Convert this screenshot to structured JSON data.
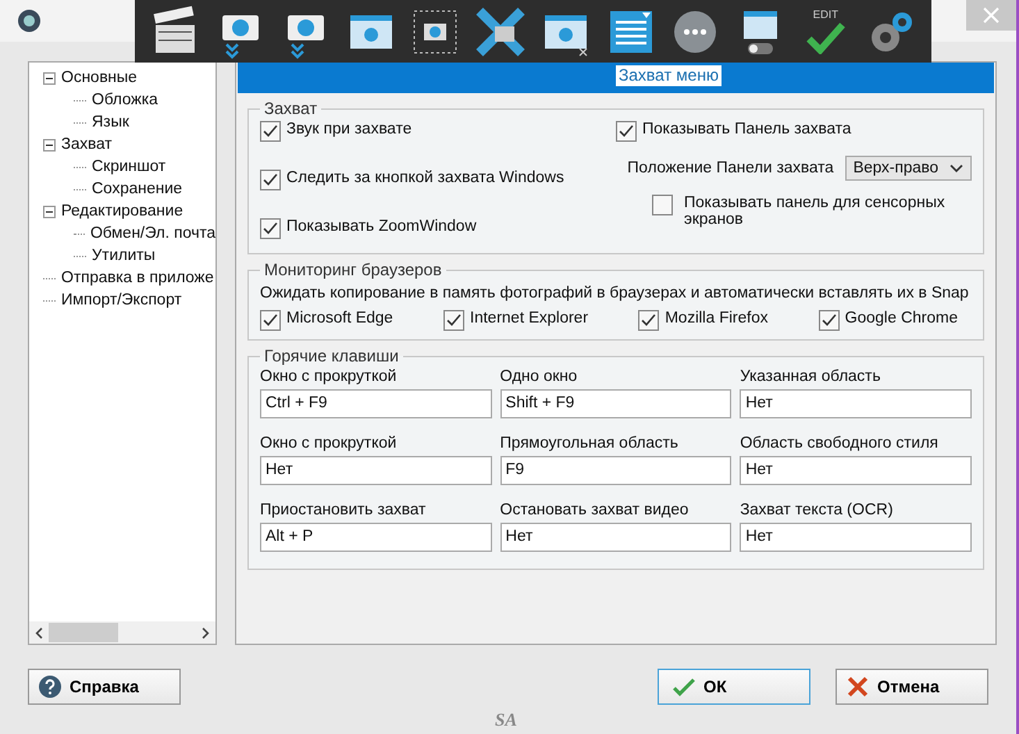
{
  "toolbar": {
    "edit_label": "EDIT",
    "tooltip": "Захват меню"
  },
  "tree": [
    {
      "label": "Основные",
      "expanded": true,
      "children": [
        {
          "label": "Обложка"
        },
        {
          "label": "Язык"
        }
      ]
    },
    {
      "label": "Захват",
      "expanded": true,
      "children": [
        {
          "label": "Скриншот"
        },
        {
          "label": "Сохранение"
        }
      ]
    },
    {
      "label": "Редактирование",
      "expanded": true,
      "children": [
        {
          "label": "Обмен/Эл. почта"
        },
        {
          "label": "Утилиты"
        }
      ]
    },
    {
      "label": "Отправка в приложе"
    },
    {
      "label": "Импорт/Экспорт"
    }
  ],
  "capture": {
    "title": "Захват",
    "left": [
      {
        "label": "Звук при захвате",
        "checked": true
      },
      {
        "label": "Следить за кнопкой захвата Windows",
        "checked": true
      },
      {
        "label": "Показывать ZoomWindow",
        "checked": true
      }
    ],
    "show_panel": {
      "label": "Показывать Панель захвата",
      "checked": true
    },
    "position": {
      "label": "Положение Панели захвата",
      "value": "Верх-право"
    },
    "touch": {
      "label": "Показывать панель для сенсорных экранов",
      "checked": false
    }
  },
  "browsers": {
    "title": "Мониторинг браузеров",
    "description": "Ожидать копирование в память фотографий в браузерах и автоматически вставлять их в Snap",
    "items": [
      {
        "label": "Microsoft Edge",
        "checked": true
      },
      {
        "label": "Internet Explorer",
        "checked": true
      },
      {
        "label": "Mozilla Firefox",
        "checked": true
      },
      {
        "label": "Google Chrome",
        "checked": true
      }
    ]
  },
  "hotkeys": {
    "title": "Горячие клавиши",
    "fields": [
      {
        "label": "Окно с прокруткой",
        "value": "Ctrl + F9"
      },
      {
        "label": "Одно окно",
        "value": "Shift + F9"
      },
      {
        "label": "Указанная область",
        "value": "Нет"
      },
      {
        "label": "Окно с прокруткой",
        "value": "Нет"
      },
      {
        "label": "Прямоугольная область",
        "value": "F9"
      },
      {
        "label": "Область свободного стиля",
        "value": "Нет"
      },
      {
        "label": "Приостановить захват",
        "value": "Alt + P"
      },
      {
        "label": "Остановать захват видео",
        "value": "Нет"
      },
      {
        "label": "Захват текста (OCR)",
        "value": "Нет"
      }
    ]
  },
  "buttons": [
    {
      "kind": "help",
      "label": "Справка"
    },
    {
      "kind": "ok",
      "label": "ОК"
    },
    {
      "kind": "cancel",
      "label": "Отмена"
    }
  ],
  "footer_logo": "SA"
}
